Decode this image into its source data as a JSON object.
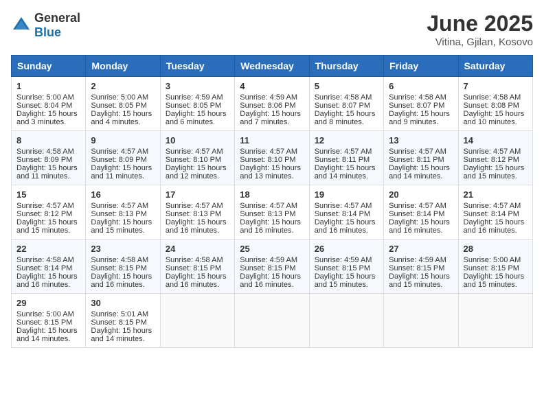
{
  "header": {
    "logo_general": "General",
    "logo_blue": "Blue",
    "month_year": "June 2025",
    "location": "Vitina, Gjilan, Kosovo"
  },
  "days_of_week": [
    "Sunday",
    "Monday",
    "Tuesday",
    "Wednesday",
    "Thursday",
    "Friday",
    "Saturday"
  ],
  "weeks": [
    [
      {
        "day": "1",
        "sunrise": "Sunrise: 5:00 AM",
        "sunset": "Sunset: 8:04 PM",
        "daylight": "Daylight: 15 hours and 3 minutes."
      },
      {
        "day": "2",
        "sunrise": "Sunrise: 5:00 AM",
        "sunset": "Sunset: 8:05 PM",
        "daylight": "Daylight: 15 hours and 4 minutes."
      },
      {
        "day": "3",
        "sunrise": "Sunrise: 4:59 AM",
        "sunset": "Sunset: 8:05 PM",
        "daylight": "Daylight: 15 hours and 6 minutes."
      },
      {
        "day": "4",
        "sunrise": "Sunrise: 4:59 AM",
        "sunset": "Sunset: 8:06 PM",
        "daylight": "Daylight: 15 hours and 7 minutes."
      },
      {
        "day": "5",
        "sunrise": "Sunrise: 4:58 AM",
        "sunset": "Sunset: 8:07 PM",
        "daylight": "Daylight: 15 hours and 8 minutes."
      },
      {
        "day": "6",
        "sunrise": "Sunrise: 4:58 AM",
        "sunset": "Sunset: 8:07 PM",
        "daylight": "Daylight: 15 hours and 9 minutes."
      },
      {
        "day": "7",
        "sunrise": "Sunrise: 4:58 AM",
        "sunset": "Sunset: 8:08 PM",
        "daylight": "Daylight: 15 hours and 10 minutes."
      }
    ],
    [
      {
        "day": "8",
        "sunrise": "Sunrise: 4:58 AM",
        "sunset": "Sunset: 8:09 PM",
        "daylight": "Daylight: 15 hours and 11 minutes."
      },
      {
        "day": "9",
        "sunrise": "Sunrise: 4:57 AM",
        "sunset": "Sunset: 8:09 PM",
        "daylight": "Daylight: 15 hours and 11 minutes."
      },
      {
        "day": "10",
        "sunrise": "Sunrise: 4:57 AM",
        "sunset": "Sunset: 8:10 PM",
        "daylight": "Daylight: 15 hours and 12 minutes."
      },
      {
        "day": "11",
        "sunrise": "Sunrise: 4:57 AM",
        "sunset": "Sunset: 8:10 PM",
        "daylight": "Daylight: 15 hours and 13 minutes."
      },
      {
        "day": "12",
        "sunrise": "Sunrise: 4:57 AM",
        "sunset": "Sunset: 8:11 PM",
        "daylight": "Daylight: 15 hours and 14 minutes."
      },
      {
        "day": "13",
        "sunrise": "Sunrise: 4:57 AM",
        "sunset": "Sunset: 8:11 PM",
        "daylight": "Daylight: 15 hours and 14 minutes."
      },
      {
        "day": "14",
        "sunrise": "Sunrise: 4:57 AM",
        "sunset": "Sunset: 8:12 PM",
        "daylight": "Daylight: 15 hours and 15 minutes."
      }
    ],
    [
      {
        "day": "15",
        "sunrise": "Sunrise: 4:57 AM",
        "sunset": "Sunset: 8:12 PM",
        "daylight": "Daylight: 15 hours and 15 minutes."
      },
      {
        "day": "16",
        "sunrise": "Sunrise: 4:57 AM",
        "sunset": "Sunset: 8:13 PM",
        "daylight": "Daylight: 15 hours and 15 minutes."
      },
      {
        "day": "17",
        "sunrise": "Sunrise: 4:57 AM",
        "sunset": "Sunset: 8:13 PM",
        "daylight": "Daylight: 15 hours and 16 minutes."
      },
      {
        "day": "18",
        "sunrise": "Sunrise: 4:57 AM",
        "sunset": "Sunset: 8:13 PM",
        "daylight": "Daylight: 15 hours and 16 minutes."
      },
      {
        "day": "19",
        "sunrise": "Sunrise: 4:57 AM",
        "sunset": "Sunset: 8:14 PM",
        "daylight": "Daylight: 15 hours and 16 minutes."
      },
      {
        "day": "20",
        "sunrise": "Sunrise: 4:57 AM",
        "sunset": "Sunset: 8:14 PM",
        "daylight": "Daylight: 15 hours and 16 minutes."
      },
      {
        "day": "21",
        "sunrise": "Sunrise: 4:57 AM",
        "sunset": "Sunset: 8:14 PM",
        "daylight": "Daylight: 15 hours and 16 minutes."
      }
    ],
    [
      {
        "day": "22",
        "sunrise": "Sunrise: 4:58 AM",
        "sunset": "Sunset: 8:14 PM",
        "daylight": "Daylight: 15 hours and 16 minutes."
      },
      {
        "day": "23",
        "sunrise": "Sunrise: 4:58 AM",
        "sunset": "Sunset: 8:15 PM",
        "daylight": "Daylight: 15 hours and 16 minutes."
      },
      {
        "day": "24",
        "sunrise": "Sunrise: 4:58 AM",
        "sunset": "Sunset: 8:15 PM",
        "daylight": "Daylight: 15 hours and 16 minutes."
      },
      {
        "day": "25",
        "sunrise": "Sunrise: 4:59 AM",
        "sunset": "Sunset: 8:15 PM",
        "daylight": "Daylight: 15 hours and 16 minutes."
      },
      {
        "day": "26",
        "sunrise": "Sunrise: 4:59 AM",
        "sunset": "Sunset: 8:15 PM",
        "daylight": "Daylight: 15 hours and 15 minutes."
      },
      {
        "day": "27",
        "sunrise": "Sunrise: 4:59 AM",
        "sunset": "Sunset: 8:15 PM",
        "daylight": "Daylight: 15 hours and 15 minutes."
      },
      {
        "day": "28",
        "sunrise": "Sunrise: 5:00 AM",
        "sunset": "Sunset: 8:15 PM",
        "daylight": "Daylight: 15 hours and 15 minutes."
      }
    ],
    [
      {
        "day": "29",
        "sunrise": "Sunrise: 5:00 AM",
        "sunset": "Sunset: 8:15 PM",
        "daylight": "Daylight: 15 hours and 14 minutes."
      },
      {
        "day": "30",
        "sunrise": "Sunrise: 5:01 AM",
        "sunset": "Sunset: 8:15 PM",
        "daylight": "Daylight: 15 hours and 14 minutes."
      },
      null,
      null,
      null,
      null,
      null
    ]
  ]
}
